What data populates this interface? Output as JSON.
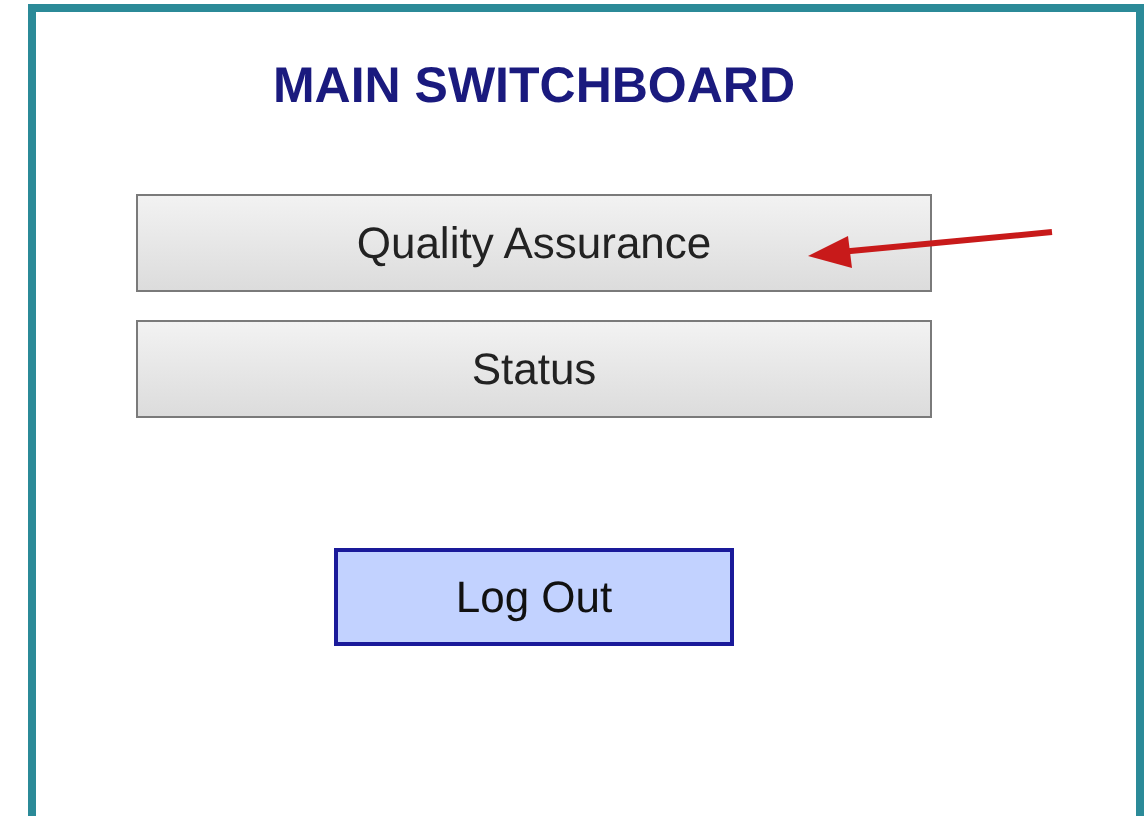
{
  "title": "MAIN SWITCHBOARD",
  "buttons": [
    {
      "label": "Quality Assurance",
      "kind": "menu"
    },
    {
      "label": "Status",
      "kind": "menu"
    },
    {
      "label": "Log Out",
      "kind": "logout"
    }
  ]
}
